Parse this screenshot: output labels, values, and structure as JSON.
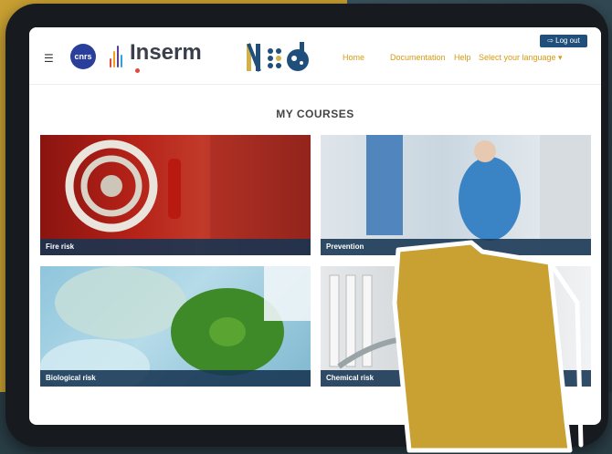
{
  "header": {
    "menu_icon": "☰",
    "cnrs_logo": "cnrs",
    "inserm_logo": "Inserm",
    "nav": [
      "Home",
      "Documentation",
      "Help"
    ],
    "language": "Select your language ▾",
    "logout": "⇨ Log out"
  },
  "page": {
    "title": "MY COURSES"
  },
  "courses": [
    {
      "label": "Fire risk"
    },
    {
      "label": "Prevention"
    },
    {
      "label": "Biological risk"
    },
    {
      "label": "Chemical risk"
    }
  ],
  "colors": {
    "accent_gold": "#c9a032",
    "nav_text": "#d99a14",
    "caption_bg": "#163452"
  }
}
